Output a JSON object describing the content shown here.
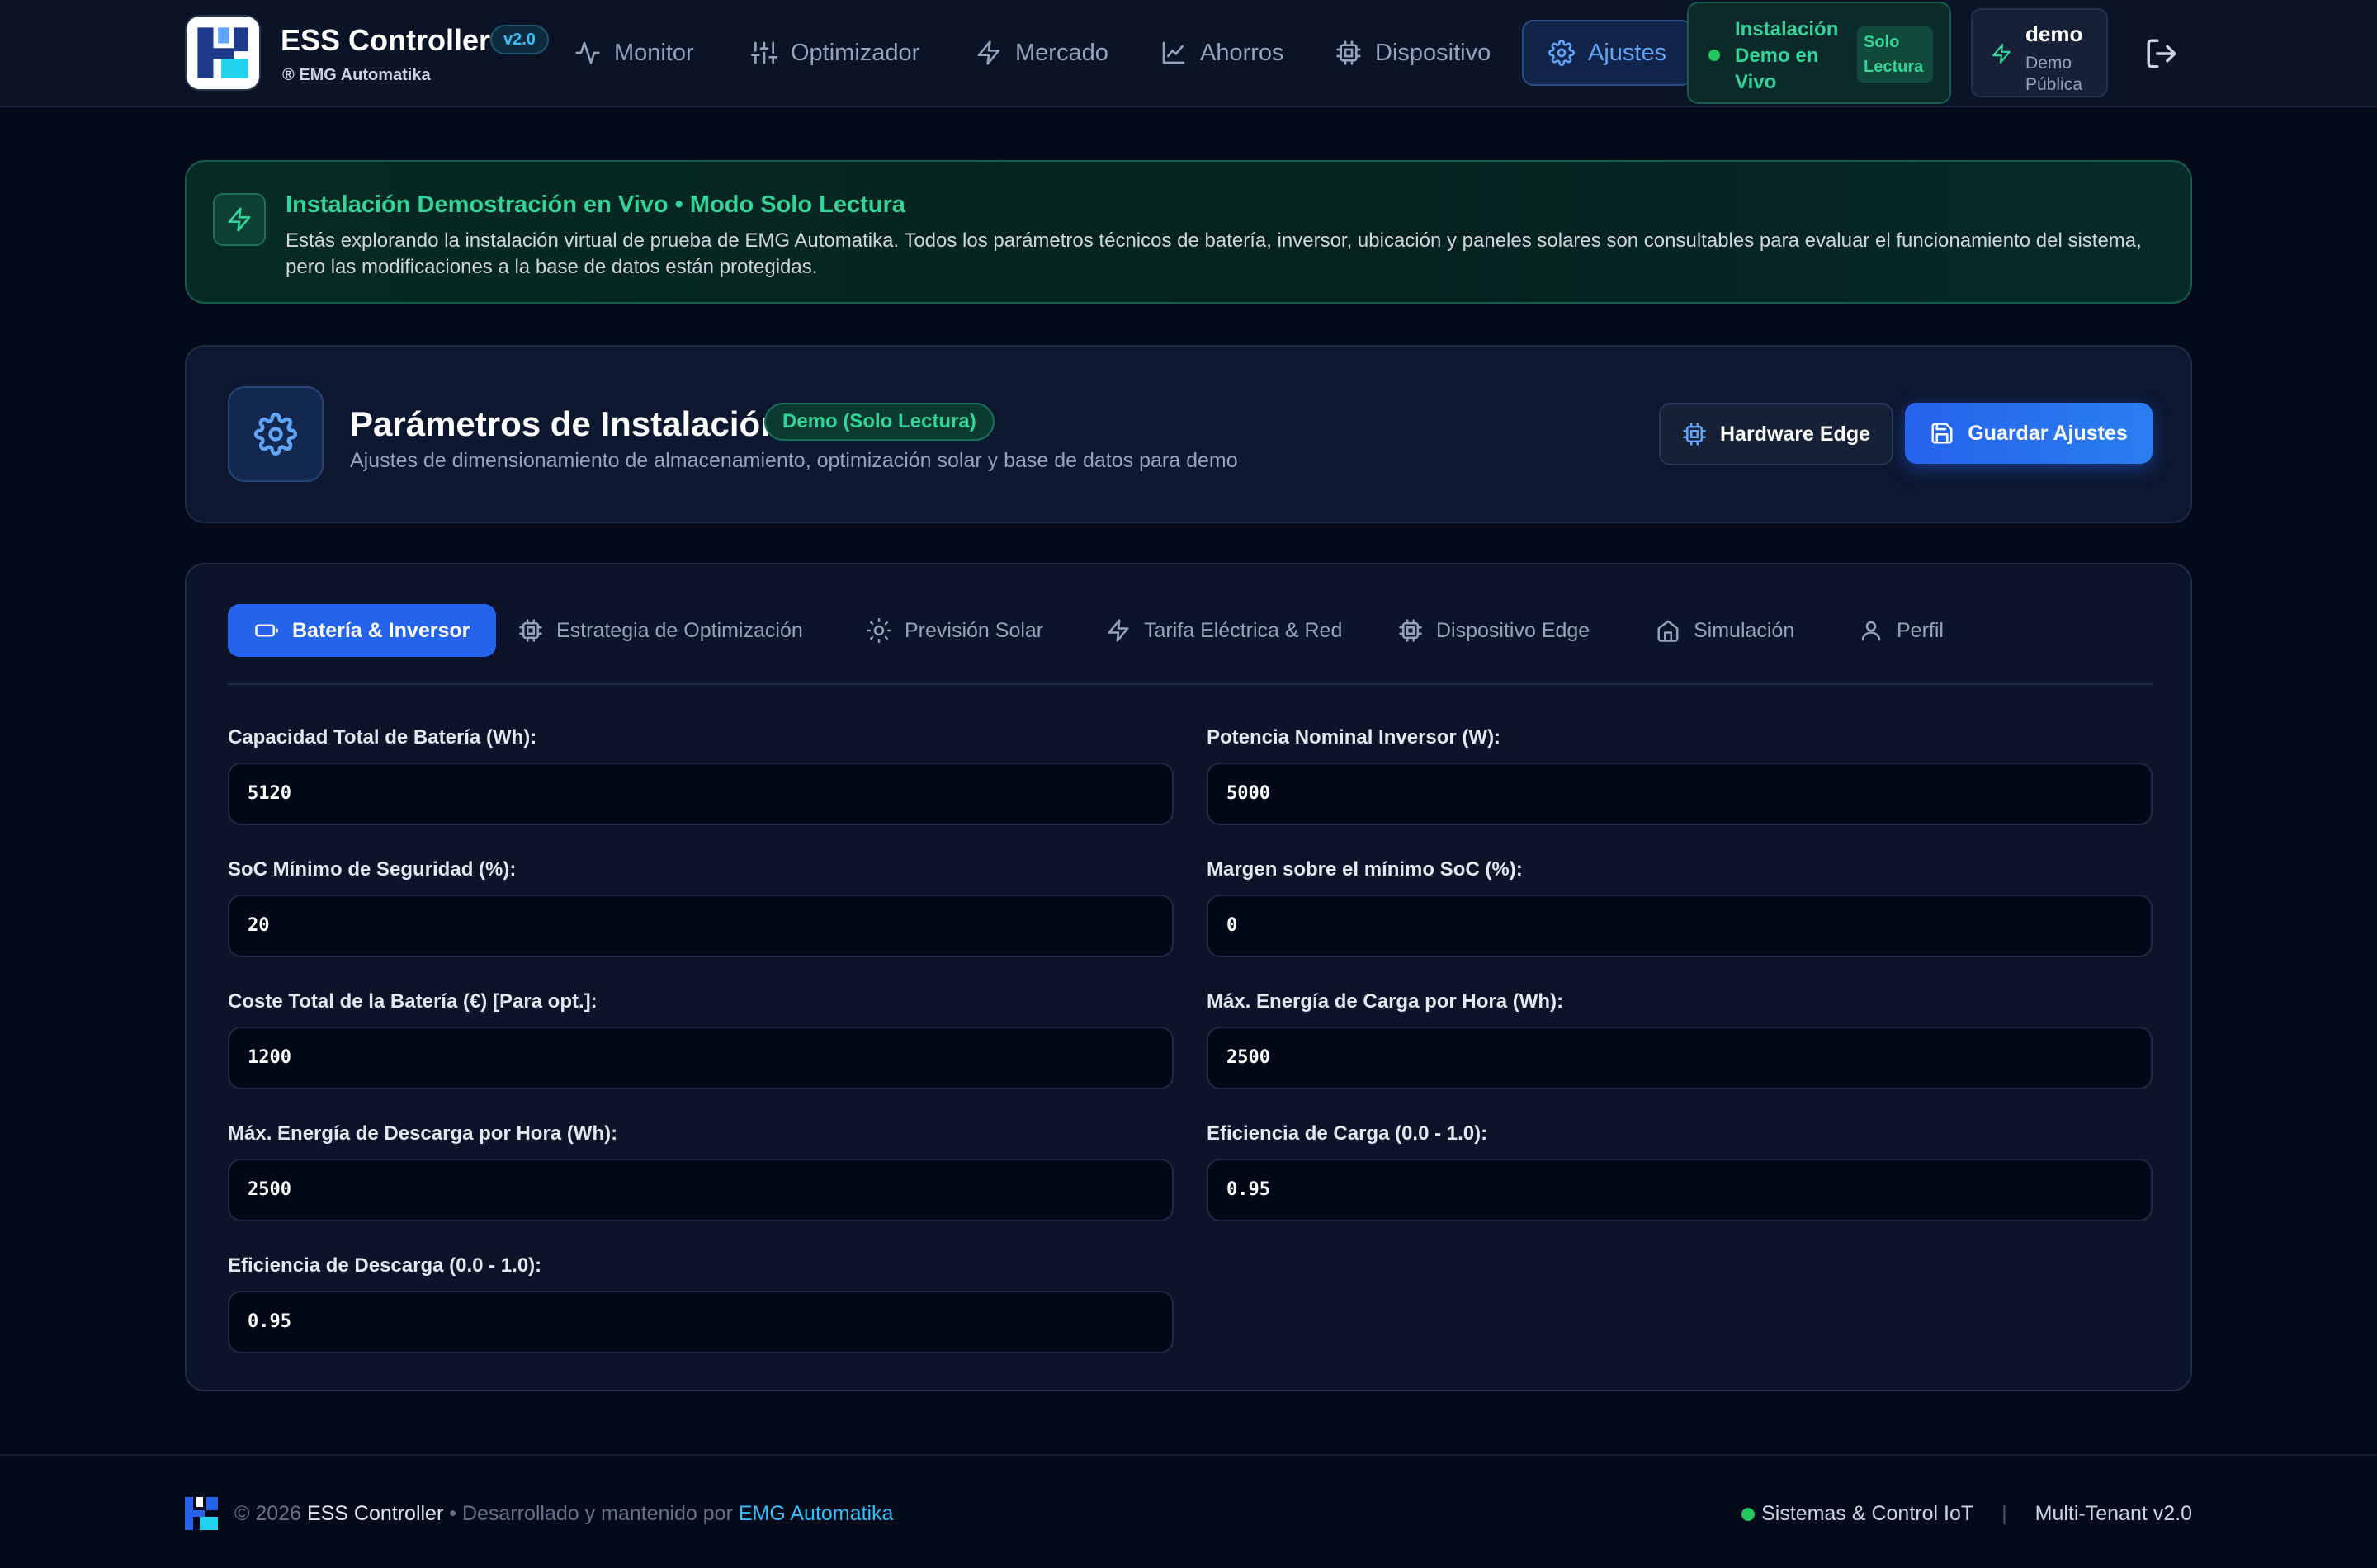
{
  "header": {
    "app_title": "ESS Controller",
    "version": "v2.0",
    "subtitle": "® EMG Automatika",
    "nav": [
      {
        "label": "Monitor",
        "icon": "activity-icon"
      },
      {
        "label": "Optimizador",
        "icon": "sliders-icon"
      },
      {
        "label": "Mercado",
        "icon": "bolt-icon"
      },
      {
        "label": "Ahorros",
        "icon": "chart-line-icon"
      },
      {
        "label": "Dispositivo",
        "icon": "chip-icon"
      },
      {
        "label": "Ajustes",
        "icon": "gear-icon",
        "active": true
      }
    ],
    "demo_status": "Instalación Demo en Vivo",
    "readonly_badge": "Solo Lectura",
    "user_name": "demo",
    "user_role": "Demo Pública"
  },
  "banner": {
    "title": "Instalación Demostración en Vivo • Modo Solo Lectura",
    "text": "Estás explorando la instalación virtual de prueba de EMG Automatika. Todos los parámetros técnicos de batería, inversor, ubicación y paneles solares son consultables para evaluar el funcionamiento del sistema, pero las modificaciones a la base de datos están protegidas."
  },
  "params": {
    "title": "Parámetros de Instalación",
    "badge": "Demo (Solo Lectura)",
    "subtitle": "Ajustes de dimensionamiento de almacenamiento, optimización solar y base de datos para demo",
    "hardware_button": "Hardware Edge",
    "save_button": "Guardar Ajustes"
  },
  "tabs": [
    {
      "label": "Batería & Inversor",
      "active": true
    },
    {
      "label": "Estrategia de Optimización"
    },
    {
      "label": "Previsión Solar"
    },
    {
      "label": "Tarifa Eléctrica & Red"
    },
    {
      "label": "Dispositivo Edge"
    },
    {
      "label": "Simulación"
    },
    {
      "label": "Perfil"
    }
  ],
  "fields": [
    {
      "label": "Capacidad Total de Batería (Wh):",
      "value": "5120"
    },
    {
      "label": "Potencia Nominal Inversor (W):",
      "value": "5000"
    },
    {
      "label": "SoC Mínimo de Seguridad (%):",
      "value": "20"
    },
    {
      "label": "Margen sobre el mínimo SoC (%):",
      "value": "0"
    },
    {
      "label": "Coste Total de la Batería (€) [Para opt.]:",
      "value": "1200"
    },
    {
      "label": "Máx. Energía de Carga por Hora (Wh):",
      "value": "2500"
    },
    {
      "label": "Máx. Energía de Descarga por Hora (Wh):",
      "value": "2500"
    },
    {
      "label": "Eficiencia de Carga (0.0 - 1.0):",
      "value": "0.95"
    },
    {
      "label": "Eficiencia de Descarga (0.0 - 1.0):",
      "value": "0.95"
    }
  ],
  "footer": {
    "copyright": "© 2026",
    "product": "ESS Controller",
    "dev_text": "• Desarrollado y mantenido por",
    "company": "EMG Automatika",
    "status": "Sistemas & Control IoT",
    "version": "Multi-Tenant v2.0"
  },
  "colors": {
    "background": "#040a1a",
    "accent_blue": "#2563eb",
    "accent_green": "#34d399",
    "accent_cyan": "#38bdf8"
  }
}
